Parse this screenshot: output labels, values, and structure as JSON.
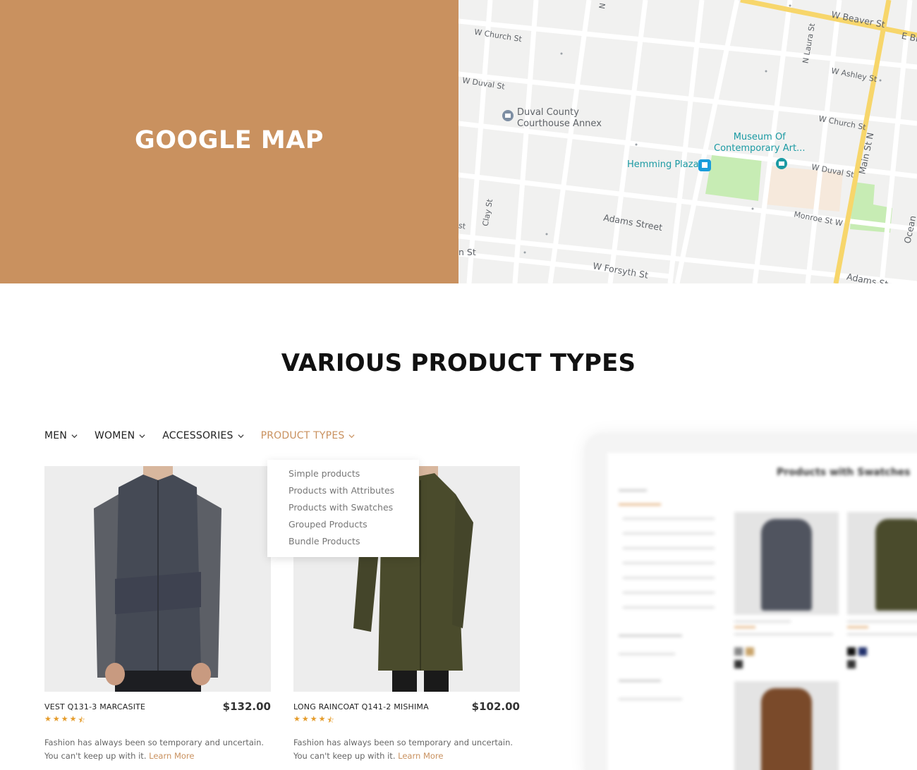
{
  "hero": {
    "title": "GOOGLE MAP"
  },
  "map": {
    "streets": [
      "W Beaver St",
      "E Bi",
      "W Church St",
      "N Laura St",
      "W Ashley St",
      "W Duval St",
      "W Church St",
      "W Duval St",
      "Main St N",
      "Adams Street",
      "Monroe St W",
      "Clay St",
      "W Forsyth St",
      "Adams St",
      "Ocean",
      "n St",
      "st",
      "N"
    ],
    "pois": {
      "courthouse": "Duval County\nCourthouse Annex",
      "museum": "Museum Of\nContemporary Art...",
      "plaza": "Hemming Plaza"
    },
    "colors": {
      "road": "#ffffff",
      "highway": "#f7d66b",
      "park": "#c7ecb4",
      "teal": "#1b9aa3",
      "blue": "#1a73e8"
    }
  },
  "section": {
    "title": "VARIOUS PRODUCT TYPES"
  },
  "nav": {
    "items": [
      {
        "label": "MEN",
        "active": false
      },
      {
        "label": "WOMEN",
        "active": false
      },
      {
        "label": "ACCESSORIES",
        "active": false
      },
      {
        "label": "PRODUCT TYPES",
        "active": true
      }
    ],
    "accent": "#c9915f"
  },
  "dropdown": {
    "items": [
      "Simple products",
      "Products with Attributes",
      "Products with Swatches",
      "Grouped Products",
      "Bundle Products"
    ]
  },
  "products": [
    {
      "name": "VEST Q131-3 MARCASITE",
      "price": "$132.00",
      "rating": 4.5,
      "desc1": "Fashion has always been so temporary and uncertain.",
      "desc2": "You can't keep up with it.",
      "learn": "Learn More",
      "swatches": [
        "#8a8a8a",
        "#c9a46a"
      ]
    },
    {
      "name": "LONG RAINCOAT Q141-2 MISHIMA",
      "price": "$102.00",
      "rating": 4.5,
      "desc1": "Fashion has always been so temporary and uncertain.",
      "desc2": "You can't keep up with it.",
      "learn": "Learn More",
      "swatches": [
        "#111111",
        "#1f2f6b"
      ]
    }
  ],
  "preview": {
    "title": "Products with Swatches"
  }
}
